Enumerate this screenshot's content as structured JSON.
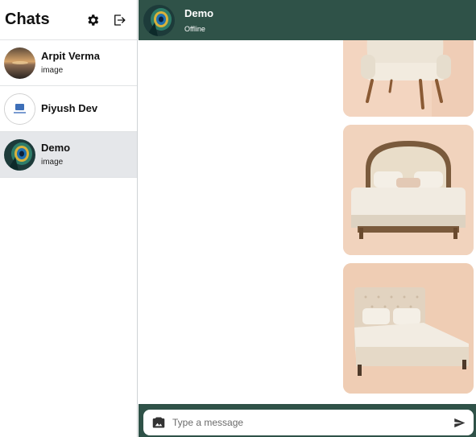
{
  "sidebar": {
    "title": "Chats",
    "chats": [
      {
        "name": "Arpit Verma",
        "preview": "image"
      },
      {
        "name": "Piyush Dev",
        "preview": ""
      },
      {
        "name": "Demo",
        "preview": "image"
      }
    ]
  },
  "header": {
    "name": "Demo",
    "status": "Offline"
  },
  "composer": {
    "placeholder": "Type a message"
  },
  "icons": {
    "settings": "gear-icon",
    "logout": "logout-icon",
    "attach": "image-icon",
    "send": "send-icon"
  },
  "colors": {
    "header_bg": "#2f5248",
    "active_chat_bg": "#e5e7ea"
  }
}
